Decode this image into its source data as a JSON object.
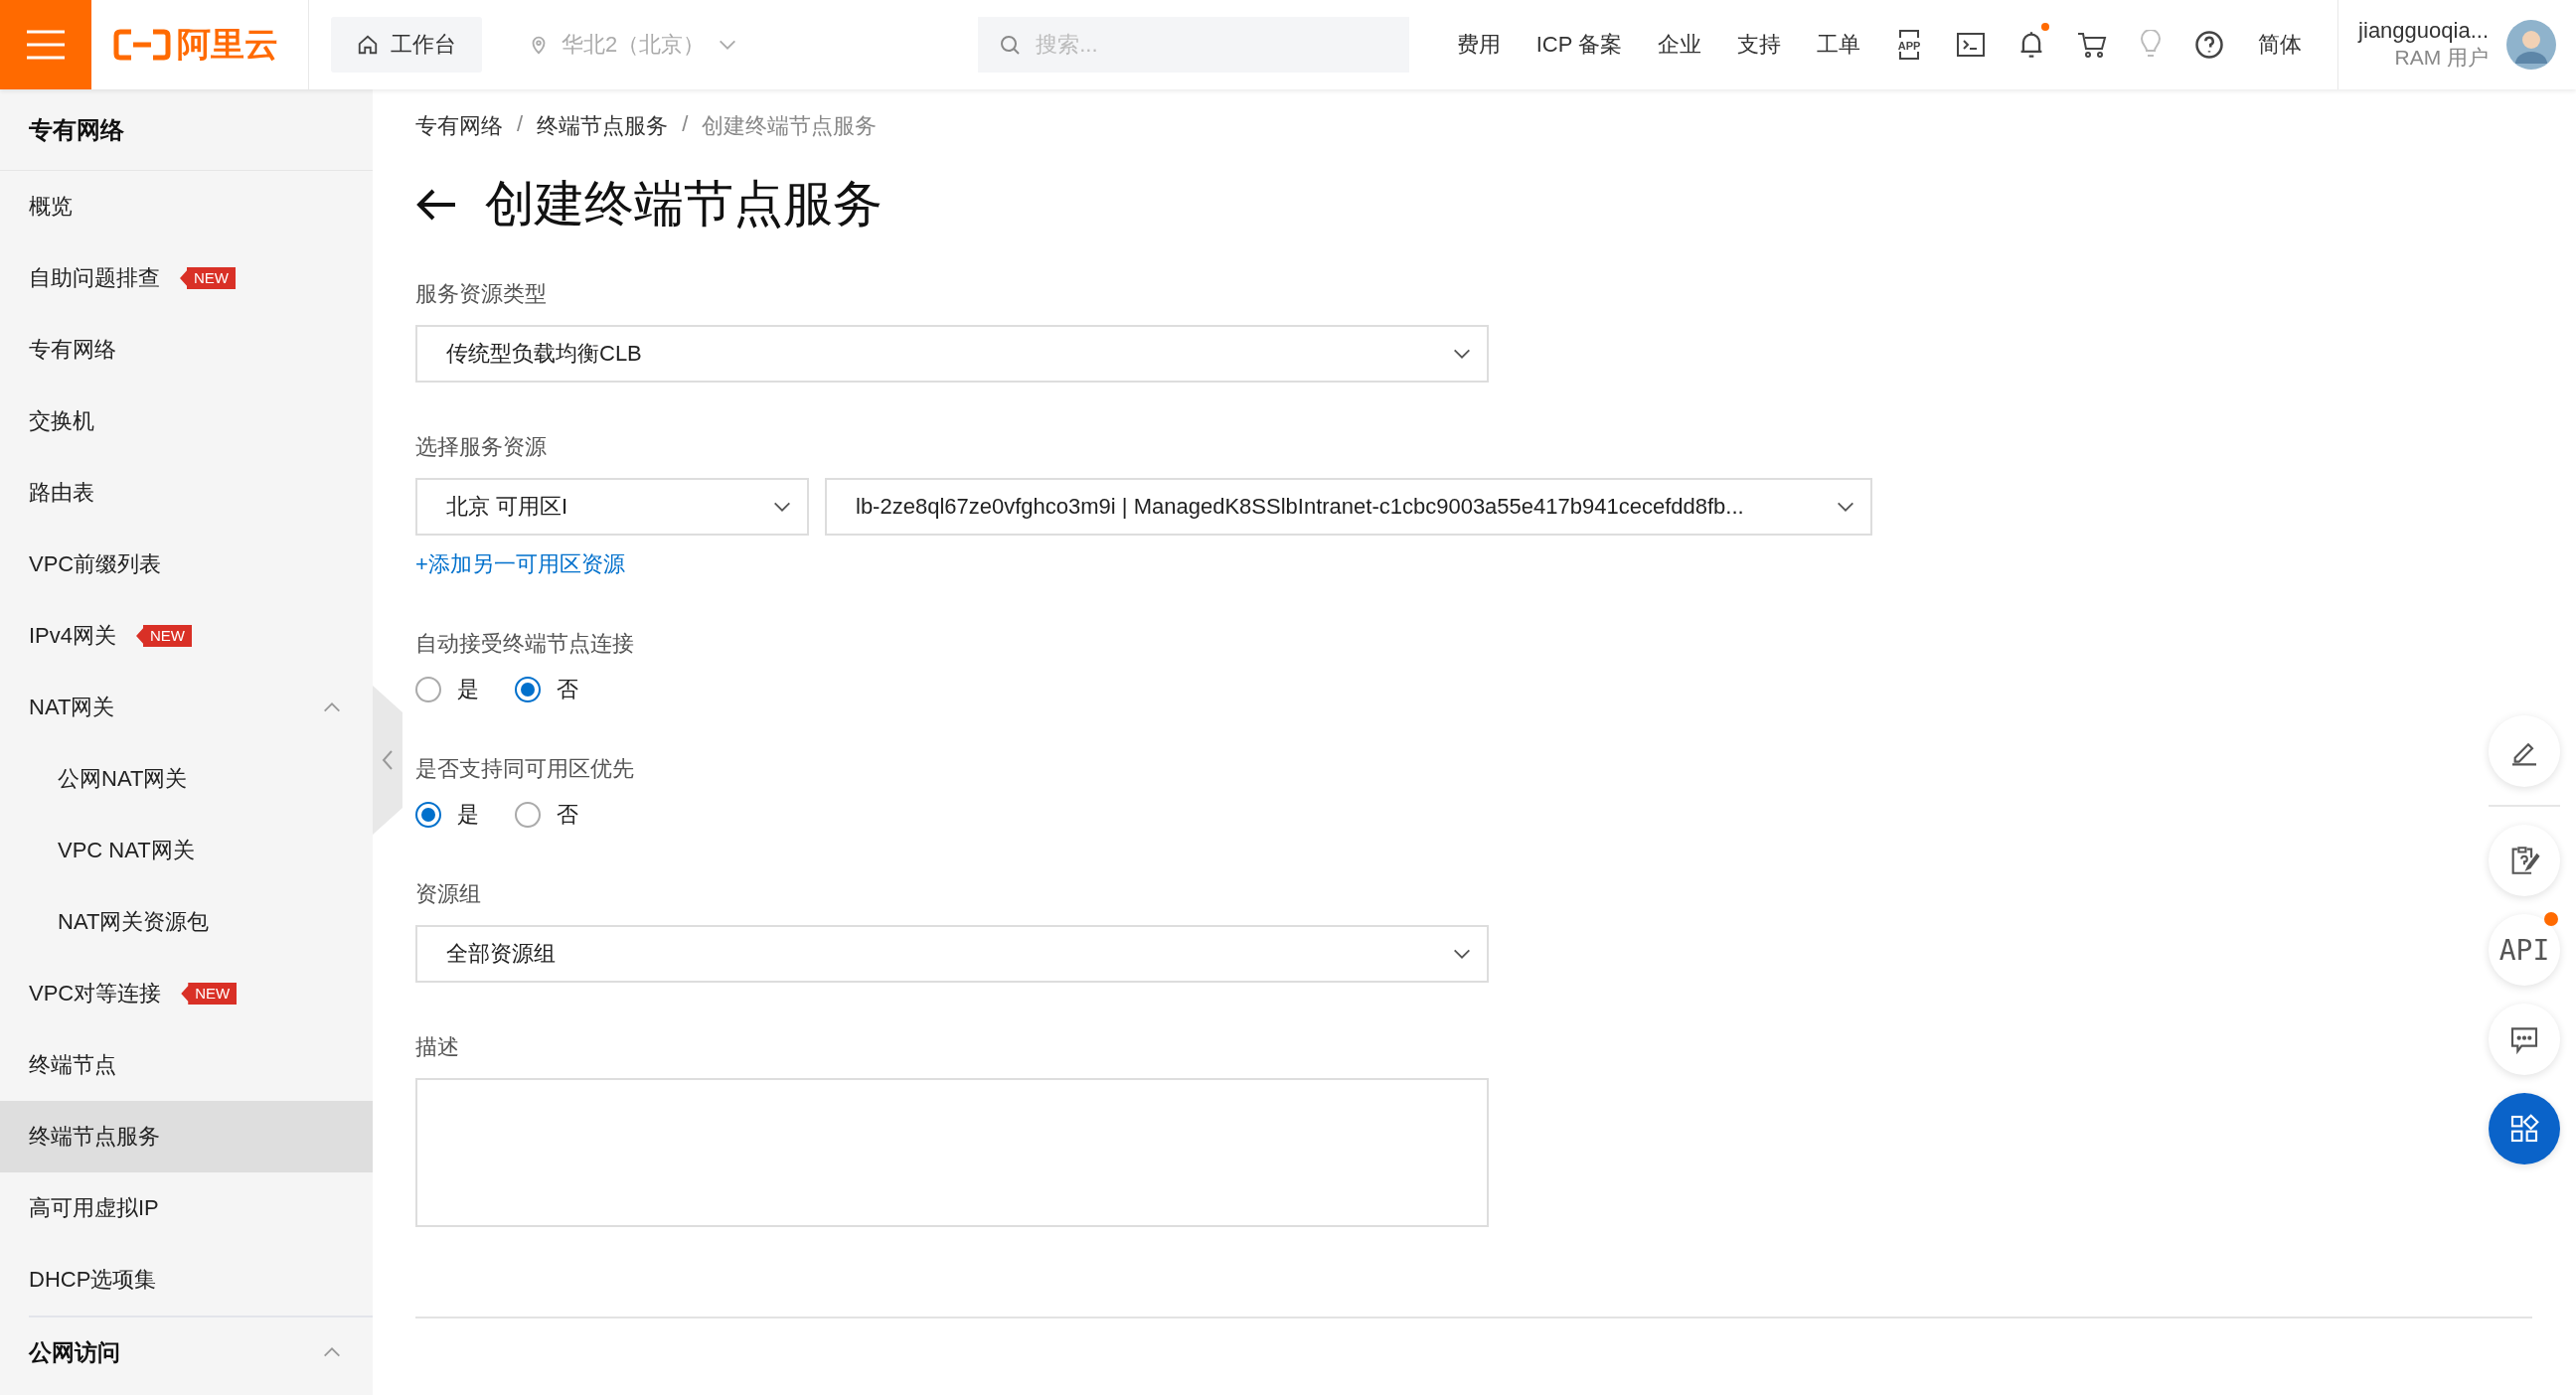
{
  "header": {
    "logo": "阿里云",
    "workbench": "工作台",
    "region": "华北2（北京）",
    "search": {
      "placeholder": "搜索..."
    },
    "links": [
      "费用",
      "ICP 备案",
      "企业",
      "支持",
      "工单"
    ],
    "app_icon_label": "APP",
    "notification_dot": true,
    "language": "简体",
    "user": {
      "name": "jiangguoqia...",
      "role": "RAM 用户"
    }
  },
  "sidebar": {
    "title": "专有网络",
    "items": [
      {
        "label": "概览",
        "selected": false
      },
      {
        "label": "自助问题排查",
        "badge": "NEW",
        "selected": false
      },
      {
        "label": "专有网络",
        "selected": false
      },
      {
        "label": "交换机",
        "selected": false
      },
      {
        "label": "路由表",
        "selected": false
      },
      {
        "label": "VPC前缀列表",
        "selected": false
      },
      {
        "label": "IPv4网关",
        "badge": "NEW",
        "selected": false
      },
      {
        "label": "NAT网关",
        "selected": false,
        "expanded": true,
        "children": [
          {
            "label": "公网NAT网关",
            "selected": false
          },
          {
            "label": "VPC NAT网关",
            "selected": false
          },
          {
            "label": "NAT网关资源包",
            "selected": false
          }
        ]
      },
      {
        "label": "VPC对等连接",
        "badge": "NEW",
        "selected": false
      },
      {
        "label": "终端节点",
        "selected": false
      },
      {
        "label": "终端节点服务",
        "selected": true
      },
      {
        "label": "高可用虚拟IP",
        "selected": false
      },
      {
        "label": "DHCP选项集",
        "selected": false
      }
    ],
    "section": {
      "label": "公网访问",
      "expanded": true
    }
  },
  "breadcrumb": [
    {
      "label": "专有网络"
    },
    {
      "separator": "/",
      "label": "终端节点服务"
    },
    {
      "separator": "/",
      "label": "创建终端节点服务"
    }
  ],
  "page_title": "创建终端节点服务",
  "form": [
    {
      "kind": "select",
      "label": "服务资源类型",
      "value": "传统型负载均衡CLB"
    },
    {
      "kind": "select_pair",
      "label": "选择服务资源",
      "zone": "北京 可用区I",
      "resource": "lb-2ze8ql67ze0vfghco3m9i | ManagedK8SSlbIntranet-c1cbc9003a55e417b941cecefdd8fb...",
      "link": "+添加另一可用区资源"
    },
    {
      "kind": "radio",
      "label": "自动接受终端节点连接",
      "options": [
        {
          "label": "是",
          "selected": false
        },
        {
          "label": "否",
          "selected": true
        }
      ]
    },
    {
      "kind": "radio",
      "label": "是否支持同可用区优先",
      "options": [
        {
          "label": "是",
          "selected": true
        },
        {
          "label": "否",
          "selected": false
        }
      ]
    },
    {
      "kind": "select",
      "label": "资源组",
      "value": "全部资源组"
    },
    {
      "kind": "textarea",
      "label": "描述"
    }
  ],
  "float_buttons": [
    {
      "kind": "edit"
    },
    {
      "kind": "feedback"
    },
    {
      "kind": "api",
      "label": "API",
      "dot": true
    },
    {
      "kind": "chat"
    },
    {
      "kind": "apps"
    }
  ]
}
